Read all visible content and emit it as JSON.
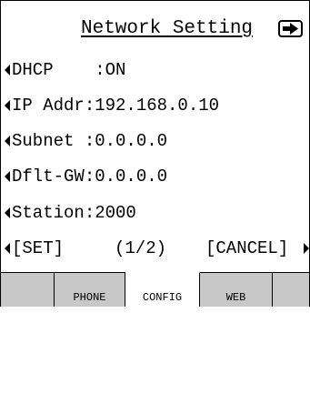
{
  "header": {
    "title": "Network Setting",
    "next_icon": "arrow-right-icon"
  },
  "settings": [
    {
      "label": "DHCP    :ON"
    },
    {
      "label": "IP Addr:192.168.0.10"
    },
    {
      "label": "Subnet :0.0.0.0"
    },
    {
      "label": "Dflt-GW:0.0.0.0"
    },
    {
      "label": "Station:2000"
    }
  ],
  "footer": {
    "set_label": "[SET]",
    "page_label": "(1/2)",
    "cancel_label": "[CANCEL]"
  },
  "tabs": [
    {
      "label": ""
    },
    {
      "label": "PHONE"
    },
    {
      "label": "CONFIG"
    },
    {
      "label": "WEB"
    },
    {
      "label": ""
    }
  ],
  "colors": {
    "tab_bar": "#c8c8c8",
    "active_tab": "#ffffff"
  }
}
